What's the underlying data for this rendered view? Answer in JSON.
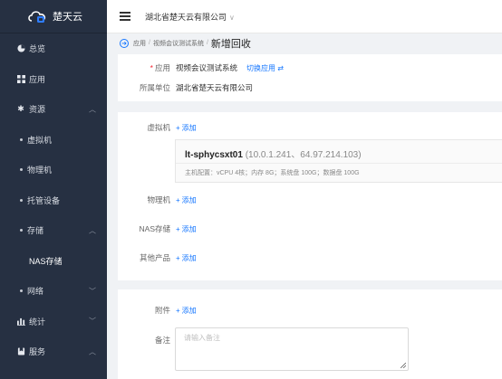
{
  "brand": {
    "name": "楚天云"
  },
  "sidebar": {
    "items": [
      {
        "label": "总览",
        "icon": "dashboard-icon"
      },
      {
        "label": "应用",
        "icon": "apps-icon"
      },
      {
        "label": "资源",
        "icon": "resource-icon",
        "expanded": true
      },
      {
        "label": "虚拟机"
      },
      {
        "label": "物理机"
      },
      {
        "label": "托管设备"
      },
      {
        "label": "存储",
        "expanded": true
      },
      {
        "label": "NAS存储"
      },
      {
        "label": "网络"
      },
      {
        "label": "统计",
        "icon": "stats-icon"
      },
      {
        "label": "服务",
        "icon": "service-icon",
        "expanded": true
      }
    ]
  },
  "topbar": {
    "org": "湖北省楚天云有限公司"
  },
  "breadcrumb": {
    "items": [
      "应用",
      "视频会议测试系统"
    ],
    "current": "新增回收"
  },
  "form": {
    "app_label": "应用",
    "app_value": "视频会议测试系统",
    "switch_app": "切换应用 ⇄",
    "unit_label": "所属单位",
    "unit_value": "湖北省楚天云有限公司",
    "vm_label": "虚拟机",
    "add": "添加",
    "vm": {
      "name": "lt-sphycsxt01",
      "ips": "(10.0.1.241、64.97.214.103)",
      "spec": "主机配置：vCPU 4核；内存 8G；系统盘 100G；数据盘 100G"
    },
    "physical_label": "物理机",
    "nas_label": "NAS存储",
    "other_label": "其他产品",
    "attachment_label": "附件",
    "remark_label": "备注",
    "remark_placeholder": "请输入备注"
  }
}
